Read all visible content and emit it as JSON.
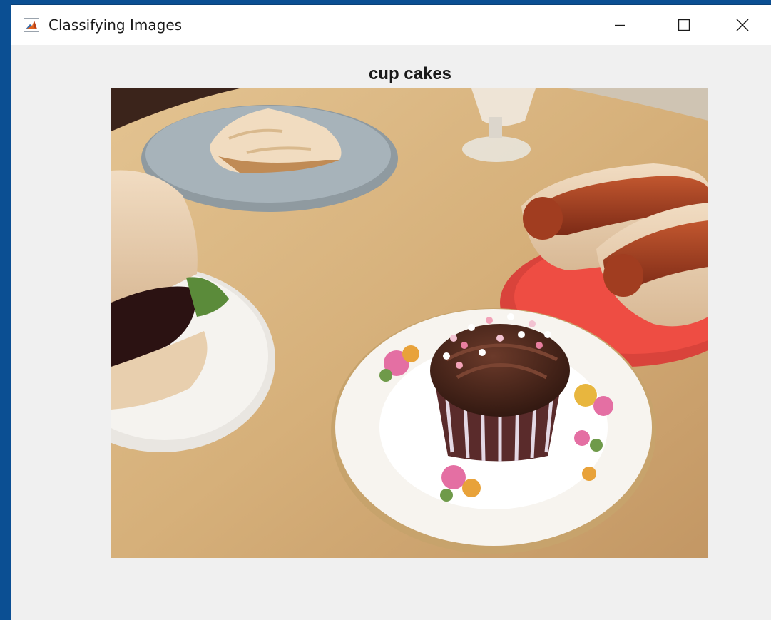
{
  "window": {
    "title": "Classifying Images",
    "app_icon": "matlab-icon",
    "controls": {
      "minimize_icon": "minimize-icon",
      "maximize_icon": "maximize-icon",
      "close_icon": "close-icon"
    }
  },
  "figure": {
    "title": "cup cakes",
    "image_description_icon": "food-photo"
  },
  "colors": {
    "desktop": "#0b4f93",
    "titlebar": "#ffffff",
    "figure_background": "#f0f0f0",
    "table": "#d2ad78"
  }
}
